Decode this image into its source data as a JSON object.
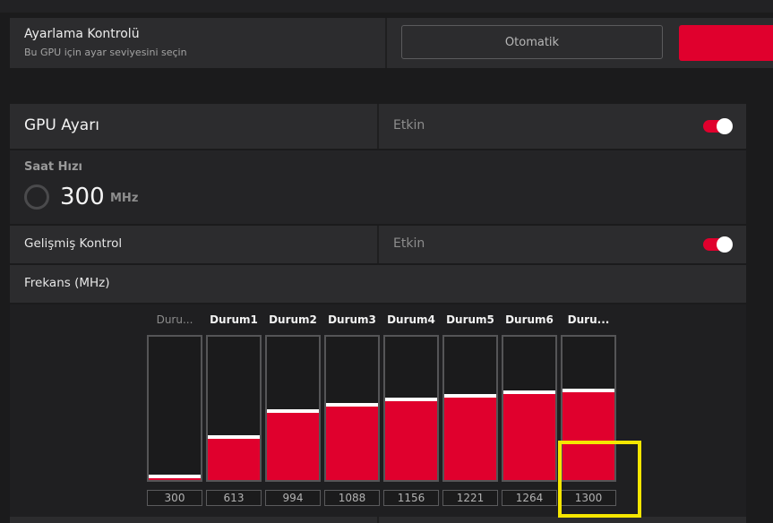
{
  "tuning_control": {
    "title": "Ayarlama Kontrolü",
    "subtitle": "Bu GPU için ayar seviyesini seçin",
    "auto_button": "Otomatik"
  },
  "gpu_tuning": {
    "title": "GPU Ayarı",
    "status": "Etkin",
    "enabled": true
  },
  "clock_speed": {
    "label": "Saat Hızı",
    "value": "300",
    "unit": "MHz"
  },
  "advanced_control": {
    "title": "Gelişmiş Kontrol",
    "status": "Etkin",
    "enabled": true
  },
  "frequency": {
    "title": "Frekans (MHz)",
    "max_value": 1300,
    "states": [
      {
        "label": "Duru...",
        "value": "300",
        "dim": true
      },
      {
        "label": "Durum1",
        "value": "613"
      },
      {
        "label": "Durum2",
        "value": "994"
      },
      {
        "label": "Durum3",
        "value": "1088"
      },
      {
        "label": "Durum4",
        "value": "1156"
      },
      {
        "label": "Durum5",
        "value": "1221"
      },
      {
        "label": "Durum6",
        "value": "1264"
      },
      {
        "label": "Duru...",
        "value": "1300"
      }
    ]
  },
  "colors": {
    "accent": "#e0002d",
    "panel": "#2c2c2e",
    "highlight": "#f5e600"
  }
}
